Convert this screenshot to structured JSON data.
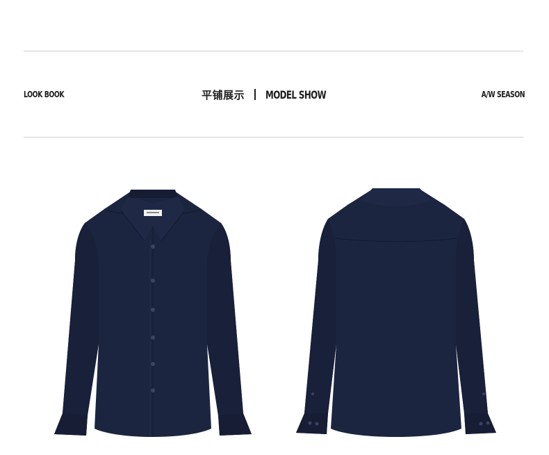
{
  "header": {
    "left_label": "LOOK BOOK",
    "title_cn": "平铺展示",
    "title_en": "MODEL SHOW",
    "right_label": "A/W SEASON"
  },
  "products": [
    {
      "view": "front",
      "color": "#1c2540"
    },
    {
      "view": "back",
      "color": "#1c2540"
    }
  ]
}
